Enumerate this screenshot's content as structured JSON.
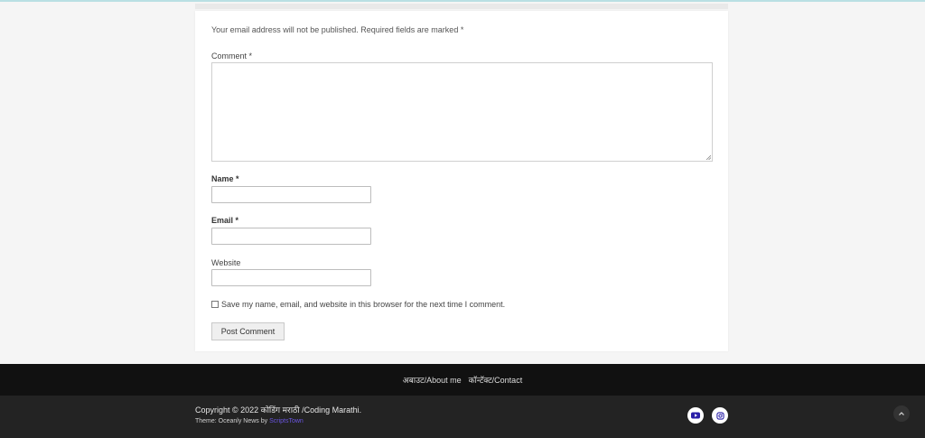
{
  "comment_form": {
    "notes": "Your email address will not be published. Required fields are marked *",
    "comment_label": "Comment *",
    "comment_value": "",
    "name_label": "Name *",
    "name_value": "",
    "email_label": "Email *",
    "email_value": "",
    "website_label": "Website",
    "website_value": "",
    "consent_label": "Save my name, email, and website in this browser for the next time I comment.",
    "consent_checked": false,
    "submit_label": "Post Comment"
  },
  "footer": {
    "menu": [
      {
        "label": "अबाउट/About me"
      },
      {
        "label": "कॉन्टॅक्ट/Contact"
      }
    ],
    "copyright": "Copyright © 2022 कोडिंग मराठी /Coding Marathi.",
    "theme_prefix": "Theme: Oceanly News by ",
    "theme_link": "ScriptsTown",
    "social": [
      {
        "icon": "youtube-icon"
      },
      {
        "icon": "instagram-icon"
      }
    ],
    "back_to_top_icon": "chevron-up-icon"
  },
  "colors": {
    "footer_nav_bg": "#111111",
    "footer_bottom_bg": "#232323",
    "accent_link": "#6a55e0",
    "youtube": "#2a1fa8"
  }
}
